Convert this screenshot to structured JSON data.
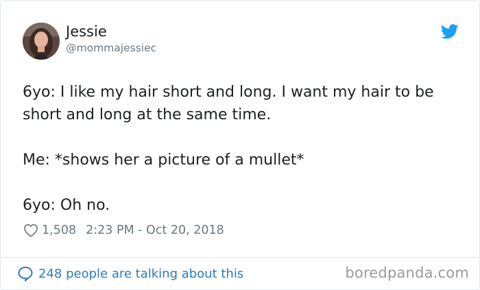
{
  "author": {
    "name": "Jessie",
    "handle": "@mommajessiec",
    "avatar_icon": "profile-photo"
  },
  "tweet": {
    "lines": [
      "6yo: I like my hair short and long. I want my hair to be short and long at the same time.",
      "Me: *shows her a picture of a mullet*",
      "6yo: Oh no."
    ]
  },
  "meta": {
    "likes": "1,508",
    "timestamp": "2:23 PM - Oct 20, 2018"
  },
  "footer": {
    "talking": "248 people are talking about this",
    "watermark": "boredpanda.com"
  },
  "colors": {
    "twitter_blue": "#1da1f2",
    "link_blue": "#2b7bb9",
    "muted": "#697882"
  }
}
